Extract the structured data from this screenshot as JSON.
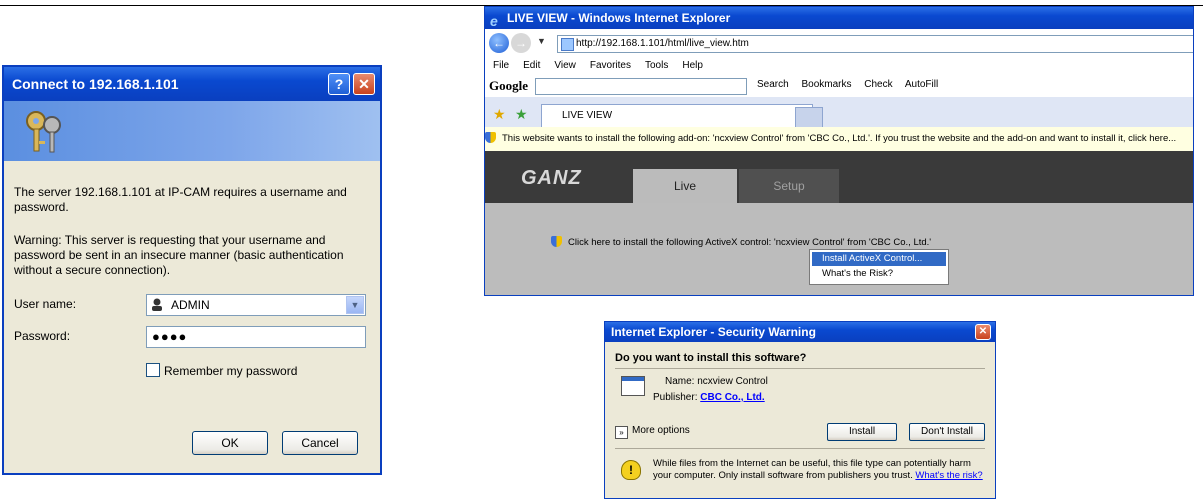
{
  "login_dialog": {
    "title": "Connect to 192.168.1.101",
    "help_label": "?",
    "close_label": "✕",
    "prompt": "The server 192.168.1.101 at IP-CAM requires a username and password.",
    "warning": "Warning: This server is requesting that your username and password be sent in an insecure manner (basic authentication without a secure connection).",
    "username_label": "User name:",
    "username_value": "ADMIN",
    "password_label": "Password:",
    "password_value": "●●●●",
    "remember_label": "Remember my password",
    "ok_label": "OK",
    "cancel_label": "Cancel"
  },
  "browser": {
    "title": "LIVE VIEW - Windows Internet Explorer",
    "url": "http://192.168.1.101/html/live_view.htm",
    "menu": [
      "File",
      "Edit",
      "View",
      "Favorites",
      "Tools",
      "Help"
    ],
    "google_logo": "Google",
    "google_tools": [
      "Search",
      "Bookmarks",
      "Check",
      "AutoFill"
    ],
    "tab_label": "LIVE VIEW",
    "infobar": "This website wants to install the following add-on: 'ncxview Control' from 'CBC Co., Ltd.'. If you trust the website and the add-on and want to install it, click here...",
    "brand": "GANZ",
    "tab_live": "Live",
    "tab_setup": "Setup",
    "activex_line": "Click here to install the following ActiveX control: 'ncxview Control' from 'CBC Co., Ltd.'",
    "context_menu": [
      "Install ActiveX Control...",
      "What's the Risk?"
    ]
  },
  "security_dialog": {
    "title": "Internet Explorer - Security Warning",
    "question": "Do you want to install this software?",
    "name_label": "Name:",
    "name_value": "ncxview Control",
    "publisher_label": "Publisher:",
    "publisher_value": "CBC Co., Ltd.",
    "more_options": "More options",
    "install_label": "Install",
    "dont_install_label": "Don't Install",
    "warning_text": "While files from the Internet can be useful, this file type can potentially harm your computer. Only install software from publishers you trust.",
    "risk_link": "What's the risk?"
  }
}
